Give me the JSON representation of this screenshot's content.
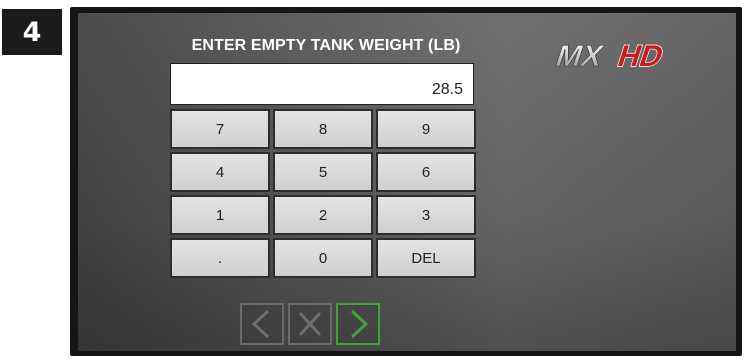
{
  "step": {
    "number": "4"
  },
  "screen": {
    "prompt": "ENTER EMPTY TANK WEIGHT (LB)",
    "logo_text": "MXHD",
    "value": "28.5"
  },
  "keypad": {
    "keys": [
      "7",
      "8",
      "9",
      "4",
      "5",
      "6",
      "1",
      "2",
      "3",
      ".",
      "0",
      "DEL"
    ]
  },
  "nav": {
    "back_icon": "chevron-left-icon",
    "cancel_icon": "x-icon",
    "confirm_icon": "chevron-right-icon"
  },
  "colors": {
    "confirm_accent": "#43a33a",
    "logo_red": "#c81e1e",
    "key_face": "#d9d9d9"
  }
}
